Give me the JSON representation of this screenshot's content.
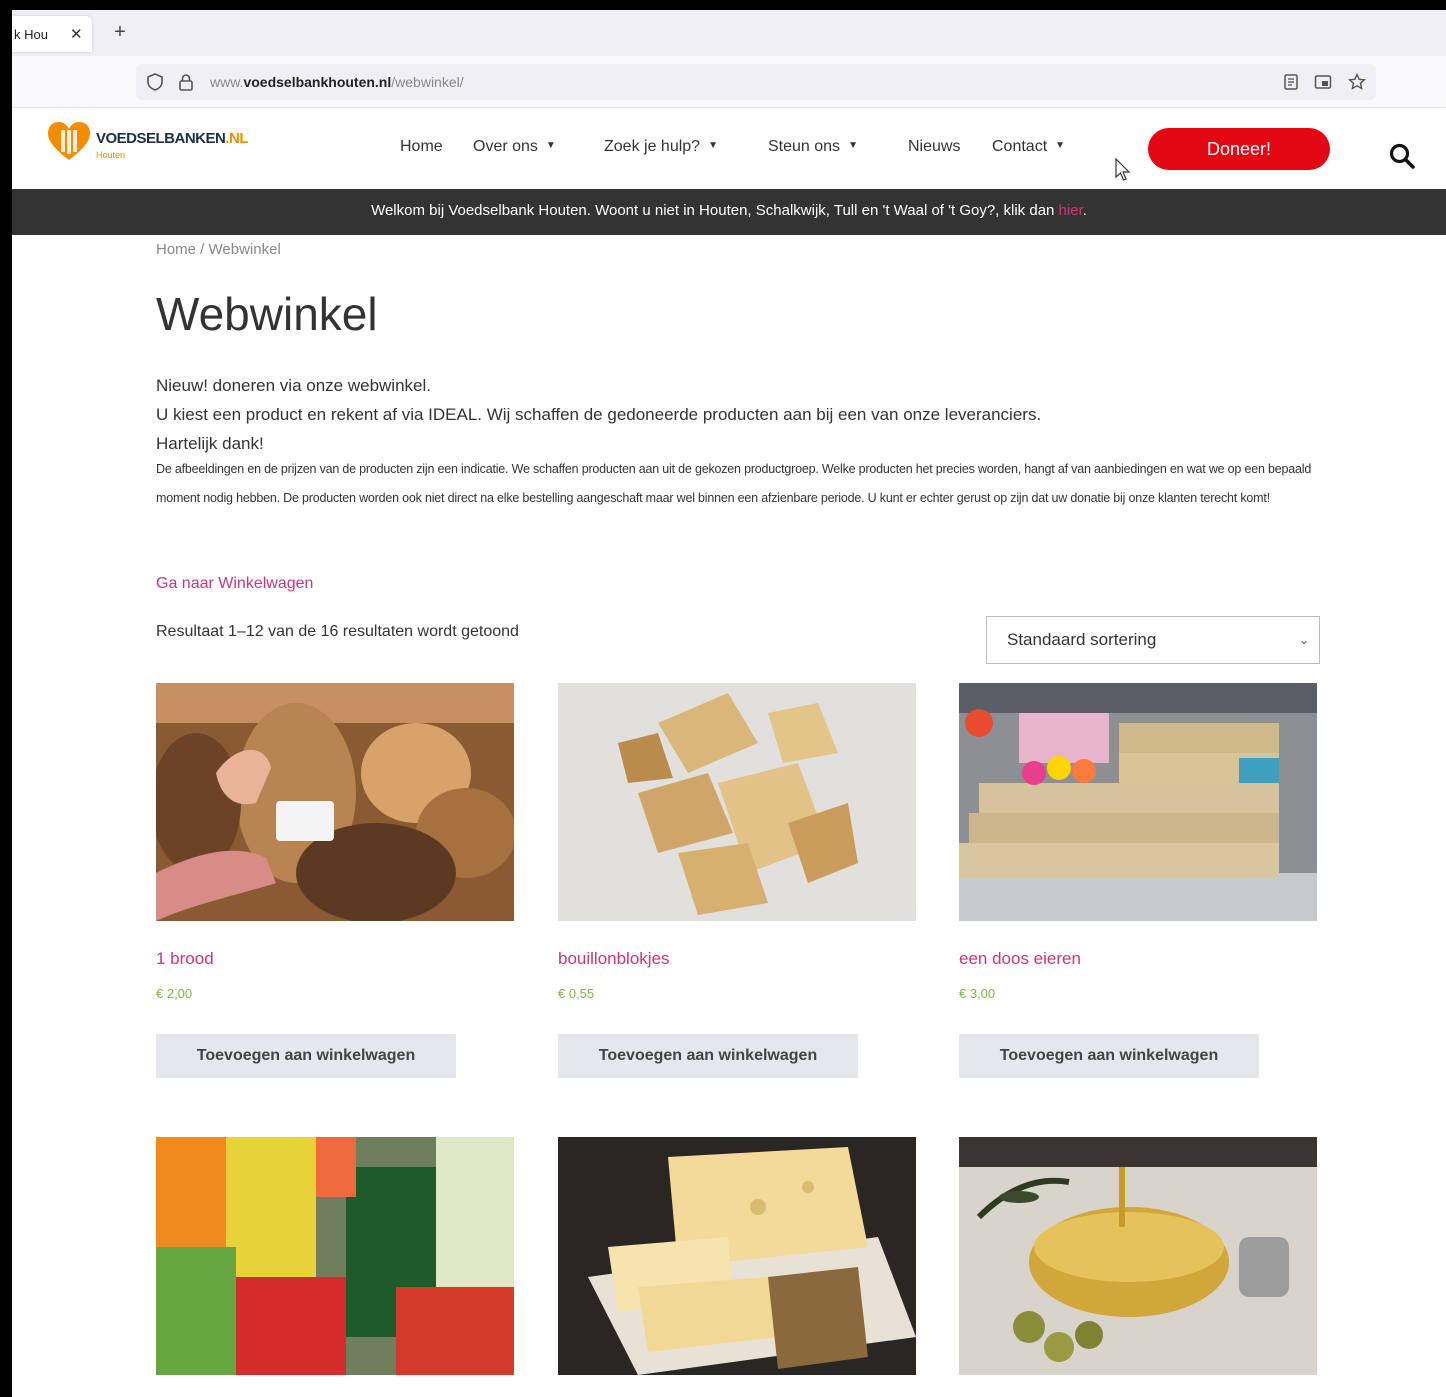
{
  "browser": {
    "tab_title": "k Hou",
    "tab_close": "✕",
    "new_tab": "+",
    "url_prefix": "www.",
    "url_domain": "voedselbankhouten.nl",
    "url_path": "/webwinkel/"
  },
  "header": {
    "logo_brand": "VOEDSELBANKEN",
    "logo_tld": ".NL",
    "logo_sub": "Houten",
    "nav": [
      {
        "label": "Home",
        "caret": ""
      },
      {
        "label": "Over ons",
        "caret": "▼"
      },
      {
        "label": "Zoek je hulp?",
        "caret": "▼"
      },
      {
        "label": "Steun ons",
        "caret": "▼"
      },
      {
        "label": "Nieuws",
        "caret": ""
      },
      {
        "label": "Contact",
        "caret": "▼"
      }
    ],
    "donate_label": "Doneer!"
  },
  "welcome": {
    "text": "Welkom bij Voedselbank Houten. Woont u niet in Houten, Schalkwijk, Tull en 't Waal of 't Goy?, klik dan ",
    "link": "hier",
    "suffix": "."
  },
  "breadcrumb": {
    "home": "Home",
    "separator": " / ",
    "current": "Webwinkel"
  },
  "page_title": "Webwinkel",
  "intro": [
    "Nieuw! doneren via onze webwinkel.",
    "U kiest een product en rekent af via IDEAL. Wij schaffen de gedoneerde producten aan bij een van onze leveranciers.",
    "Hartelijk dank!"
  ],
  "disclaimer": "De afbeeldingen en de prijzen van de producten zijn een indicatie. We schaffen producten aan uit de gekozen productgroep. Welke producten het precies worden, hangt af van aanbiedingen en wat we op een bepaald moment nodig hebben. De producten worden ook niet direct na elke bestelling aangeschaft maar wel binnen een afzienbare periode. U kunt er echter gerust op zijn dat uw donatie bij onze klanten terecht komt!",
  "cart_link": "Ga naar Winkelwagen",
  "result_count": "Resultaat 1–12 van de 16 resultaten wordt getoond",
  "sort": {
    "selected": "Standaard sortering",
    "chevron": "⌄"
  },
  "products": [
    {
      "name": "1 brood",
      "price": "€ 2,00",
      "button": "Toevoegen aan winkelwagen"
    },
    {
      "name": "bouillonblokjes",
      "price": "€ 0,55",
      "button": "Toevoegen aan winkelwagen"
    },
    {
      "name": "een doos eieren",
      "price": "€ 3,00",
      "button": "Toevoegen aan winkelwagen"
    }
  ],
  "colors": {
    "accent_pink": "#c8377a",
    "donate_red": "#e30613",
    "price_green": "#7ab648",
    "welcome_bar": "#333333",
    "logo_orange": "#f28c00"
  },
  "icons": [
    "shield-icon",
    "lock-icon",
    "reader-view-icon",
    "picture-in-picture-icon",
    "bookmark-star-icon",
    "search-icon",
    "heart-logo-icon",
    "mouse-cursor-icon"
  ]
}
